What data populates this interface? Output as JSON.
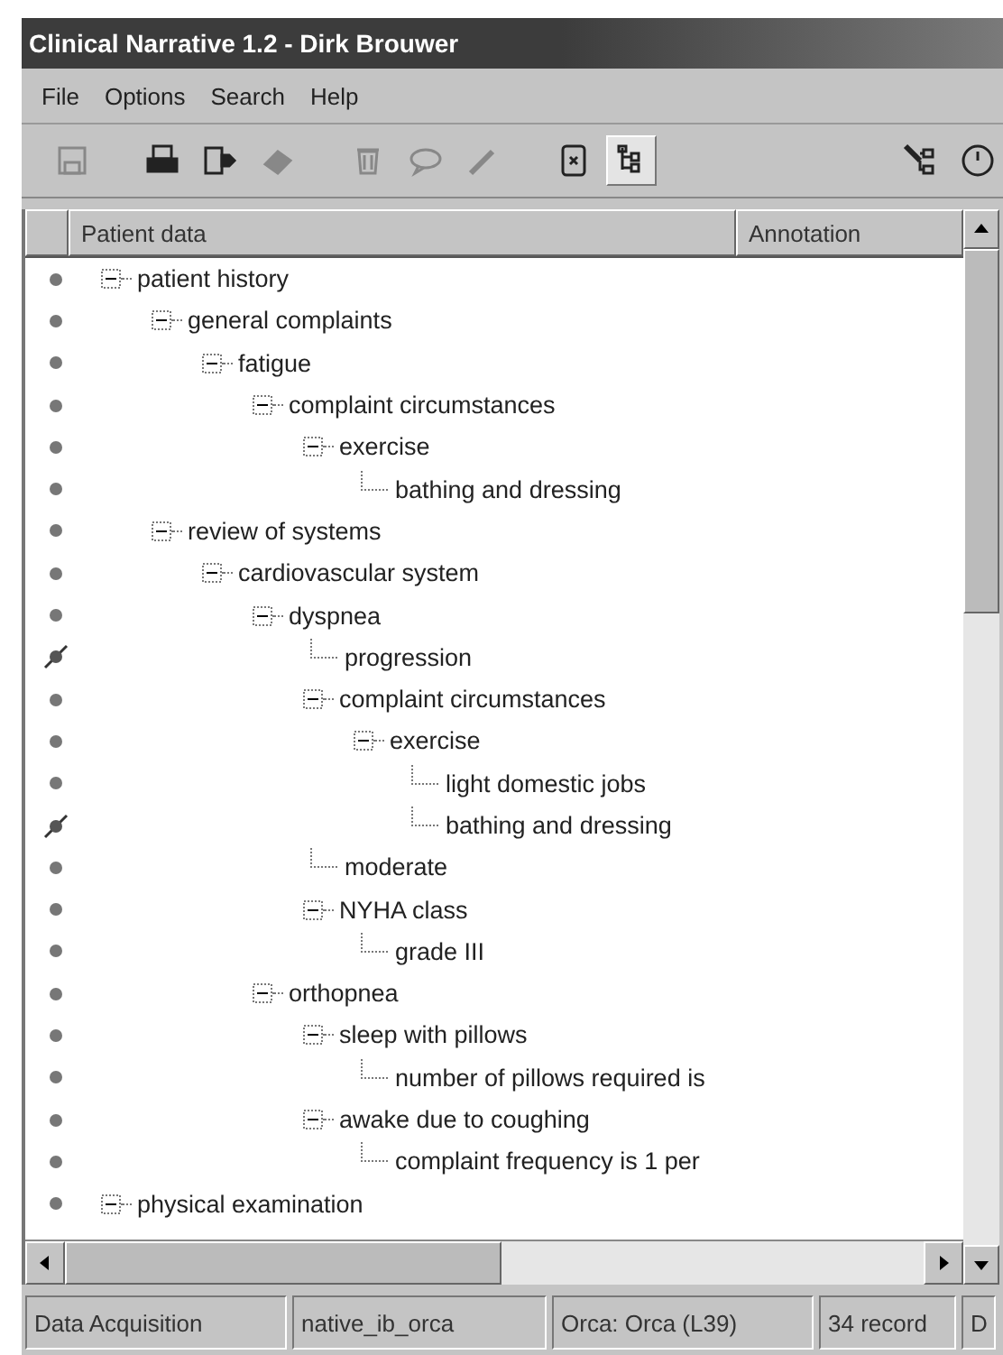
{
  "window": {
    "title": "Clinical Narrative 1.2 - Dirk Brouwer"
  },
  "menu": [
    {
      "label": "File"
    },
    {
      "label": "Options"
    },
    {
      "label": "Search"
    },
    {
      "label": "Help"
    }
  ],
  "toolbar": [
    {
      "kind": "save",
      "disabled": true,
      "selected": false
    },
    {
      "kind": "gap"
    },
    {
      "kind": "print",
      "disabled": false,
      "selected": false
    },
    {
      "kind": "export",
      "disabled": false,
      "selected": false
    },
    {
      "kind": "eraser",
      "disabled": true,
      "selected": false
    },
    {
      "kind": "gap"
    },
    {
      "kind": "trash",
      "disabled": true,
      "selected": false
    },
    {
      "kind": "comment",
      "disabled": true,
      "selected": false
    },
    {
      "kind": "wand",
      "disabled": true,
      "selected": false
    },
    {
      "kind": "gap"
    },
    {
      "kind": "document",
      "disabled": false,
      "selected": false
    },
    {
      "kind": "tree",
      "disabled": false,
      "selected": true
    },
    {
      "kind": "spacer"
    },
    {
      "kind": "network",
      "disabled": false,
      "selected": false
    },
    {
      "kind": "clock",
      "disabled": false,
      "selected": false
    }
  ],
  "table": {
    "columns": [
      "Patient data",
      "Annotation"
    ]
  },
  "tree": [
    {
      "label": "patient history",
      "marked": false,
      "expanded": true,
      "children": [
        {
          "label": "general complaints",
          "marked": false,
          "expanded": true,
          "children": [
            {
              "label": "fatigue",
              "marked": false,
              "expanded": true,
              "children": [
                {
                  "label": "complaint circumstances",
                  "marked": false,
                  "expanded": true,
                  "children": [
                    {
                      "label": "exercise",
                      "marked": false,
                      "expanded": true,
                      "children": [
                        {
                          "label": "bathing and dressing",
                          "marked": false
                        }
                      ]
                    }
                  ]
                }
              ]
            }
          ]
        },
        {
          "label": "review of systems",
          "marked": false,
          "expanded": true,
          "children": [
            {
              "label": "cardiovascular system",
              "marked": false,
              "expanded": true,
              "children": [
                {
                  "label": "dyspnea",
                  "marked": false,
                  "expanded": true,
                  "children": [
                    {
                      "label": "progression",
                      "marked": true
                    },
                    {
                      "label": "complaint circumstances",
                      "marked": false,
                      "expanded": true,
                      "children": [
                        {
                          "label": "exercise",
                          "marked": false,
                          "expanded": true,
                          "children": [
                            {
                              "label": "light domestic jobs",
                              "marked": false
                            },
                            {
                              "label": "bathing and dressing",
                              "marked": true
                            }
                          ]
                        }
                      ]
                    },
                    {
                      "label": "moderate",
                      "marked": false
                    },
                    {
                      "label": "NYHA class",
                      "marked": false,
                      "expanded": true,
                      "children": [
                        {
                          "label": "grade III",
                          "marked": false
                        }
                      ]
                    }
                  ]
                },
                {
                  "label": "orthopnea",
                  "marked": false,
                  "expanded": true,
                  "children": [
                    {
                      "label": "sleep with pillows",
                      "marked": false,
                      "expanded": true,
                      "children": [
                        {
                          "label": "number of pillows required is",
                          "marked": false
                        }
                      ]
                    },
                    {
                      "label": "awake due to coughing",
                      "marked": false,
                      "expanded": true,
                      "children": [
                        {
                          "label": "complaint frequency is 1 per",
                          "marked": false
                        }
                      ]
                    }
                  ]
                }
              ]
            }
          ]
        }
      ]
    },
    {
      "label": "physical examination",
      "marked": false,
      "expanded": true
    }
  ],
  "status_bar": [
    "Data Acquisition",
    "native_ib_orca",
    "Orca: Orca (L39)",
    "34 record",
    "D"
  ]
}
